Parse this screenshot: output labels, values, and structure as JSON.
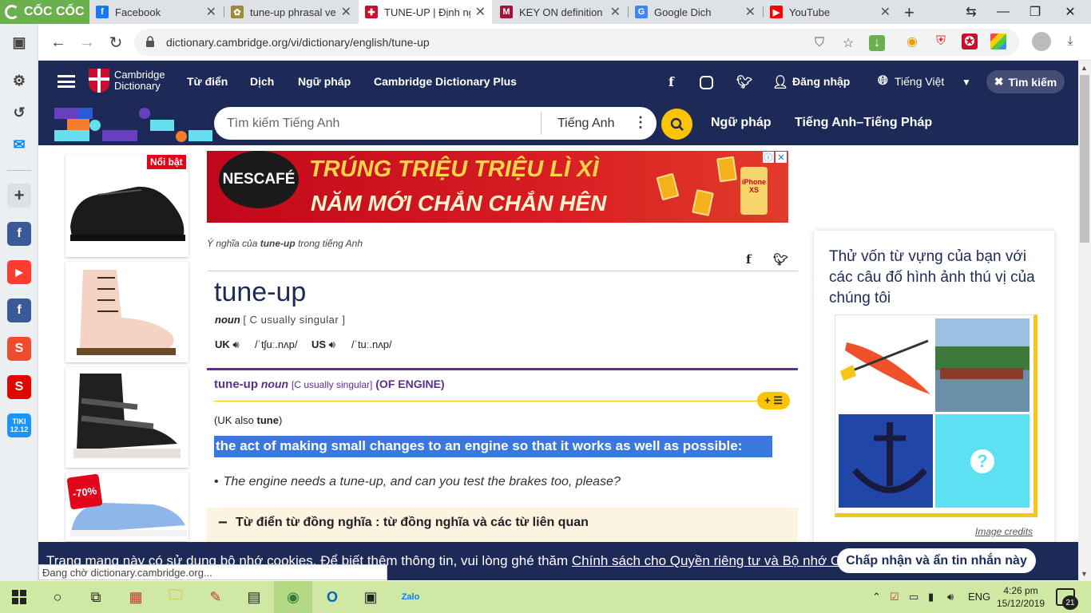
{
  "browser": {
    "brand": "CỐC CỐC",
    "tabs": [
      {
        "title": "Facebook",
        "favicon": "facebook-icon",
        "color": "#1877f2",
        "glyph": "f"
      },
      {
        "title": "tune-up phrasal verb",
        "favicon": "generic-icon",
        "color": "#9b8b3a",
        "glyph": "✿"
      },
      {
        "title": "TUNE-UP | Định nghĩa",
        "favicon": "cambridge-icon",
        "color": "#c8102e",
        "glyph": "✚"
      },
      {
        "title": "KEY ON definition fro",
        "favicon": "collins-icon",
        "color": "#a3123a",
        "glyph": "M"
      },
      {
        "title": "Google Dich",
        "favicon": "google-translate-icon",
        "color": "#4285f4",
        "glyph": "G"
      },
      {
        "title": "YouTube",
        "favicon": "youtube-icon",
        "color": "#ff0000",
        "glyph": "▶"
      }
    ],
    "url": "dictionary.cambridge.org/vi/dictionary/english/tune-up",
    "status": "Đang chờ dictionary.cambridge.org..."
  },
  "sidepanel": {
    "items": [
      {
        "name": "facebook",
        "label": "f",
        "color": "#3b5998"
      },
      {
        "name": "youtube",
        "label": "▶",
        "color": "#ff3b30"
      },
      {
        "name": "facebook",
        "label": "f",
        "color": "#3b5998"
      },
      {
        "name": "shopee",
        "label": "S",
        "color": "#ee4d2d"
      },
      {
        "name": "sendo",
        "label": "S",
        "color": "#e10600"
      },
      {
        "name": "tiki",
        "label": "TIKI 12.12",
        "color": "#1a94ff"
      }
    ]
  },
  "header": {
    "logo_line1": "Cambridge",
    "logo_line2": "Dictionary",
    "nav": [
      "Từ điển",
      "Dịch",
      "Ngữ pháp",
      "Cambridge Dictionary Plus"
    ],
    "login": "Đăng nhập",
    "language": "Tiếng Việt",
    "search_toggle": "Tìm kiếm"
  },
  "search": {
    "placeholder": "Tìm kiếm Tiếng Anh",
    "lang": "Tiếng Anh",
    "links": [
      "Ngữ pháp",
      "Tiếng Anh–Tiếng Pháp"
    ]
  },
  "ads": {
    "left_badge_new": "Nổi bật",
    "left_badge_off": "-70%",
    "banner_brand": "NESCAFÉ",
    "banner_line1": "TRÚNG TRIỆU TRIỆU LÌ XÌ",
    "banner_line2": "NĂM MỚI CHẮN CHẮN HÊN",
    "banner_phone": "iPhone XS"
  },
  "entry": {
    "meaning_prefix": "Ý nghĩa của",
    "meaning_word": "tune-up",
    "meaning_suffix": "trong tiếng Anh",
    "headword": "tune-up",
    "pos": "noun",
    "grammar": "[ C usually singular ]",
    "uk_label": "UK",
    "uk_ipa": "/ˈtʃuː.nʌp/",
    "us_label": "US",
    "us_ipa": "/ˈtuː.nʌp/",
    "sense_word": "tune-up",
    "sense_pos": "noun",
    "sense_gram": "[C usually singular]",
    "sense_guide": "(OF ENGINE)",
    "plus_label": "+ ☰",
    "variant_open": "(",
    "variant_region": "UK also",
    "variant_word": "tune",
    "variant_close": ")",
    "definition": "the act of making small changes to an engine so that it works as well as possible:",
    "example": "The engine needs a tune-up, and can you test the brakes too, please?",
    "synonyms_bar": "Từ điển từ đồng nghĩa : từ đồng nghĩa và các từ liên quan"
  },
  "quiz": {
    "question": "Thử vốn từ vựng của bạn với các câu đố hình ảnh thú vị của chúng tôi",
    "credits": "Image credits",
    "mystery": "?"
  },
  "cookie": {
    "text": "Trang mạng này có sử dụng bộ nhớ cookies. Để biết thêm thông tin, vui lòng ghé thăm",
    "link": "Chính sách cho Quyền riêng tư và Bộ nhớ Cookies",
    "end": ".",
    "button": "Chấp nhận và ẩn tin nhắn này"
  },
  "taskbar": {
    "lang": "ENG",
    "time": "4:26 pm",
    "date": "15/12/2019",
    "notifications": "21"
  },
  "colors": {
    "cambridge_navy": "#1d2a57",
    "accent_yellow": "#fec400",
    "sense_purple": "#5c2e91",
    "highlight_blue": "#3b78de"
  }
}
